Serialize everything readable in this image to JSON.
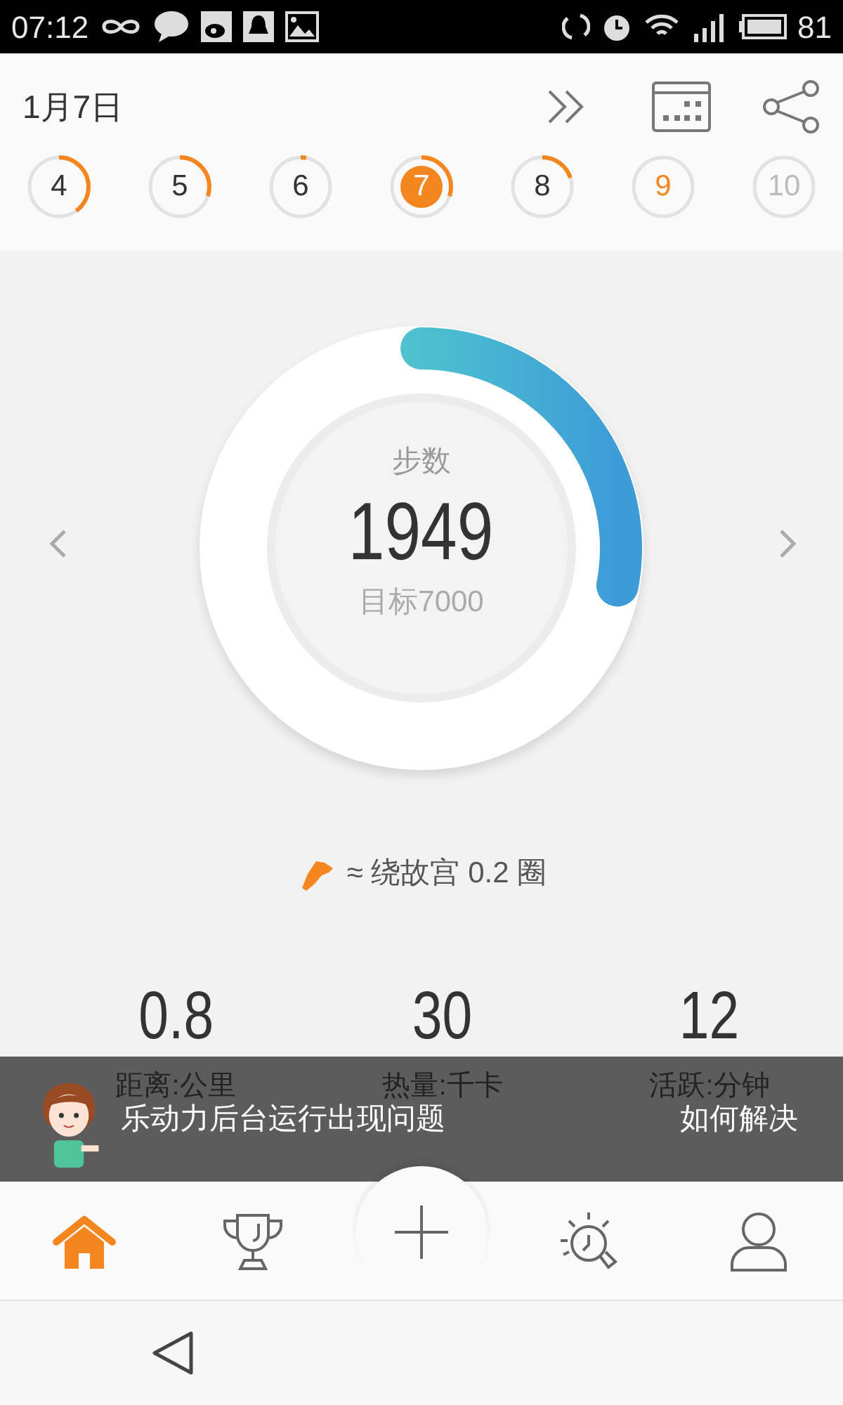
{
  "status_bar": {
    "time": "07:12",
    "battery": "81"
  },
  "header": {
    "date": "1月7日"
  },
  "days": [
    {
      "label": "4",
      "kind": "past",
      "level": 0.4,
      "selected": false
    },
    {
      "label": "5",
      "kind": "past",
      "level": 0.3,
      "selected": false
    },
    {
      "label": "6",
      "kind": "past",
      "level": 0.03,
      "selected": false
    },
    {
      "label": "7",
      "kind": "past",
      "level": 0.3,
      "selected": true
    },
    {
      "label": "8",
      "kind": "past",
      "level": 0.2,
      "selected": false
    },
    {
      "label": "9",
      "kind": "today",
      "selected": false
    },
    {
      "label": "10",
      "kind": "future",
      "selected": false
    }
  ],
  "steps": {
    "label": "步数",
    "value": "1949",
    "goal": "目标7000",
    "level": 0.28
  },
  "equivalent": "≈ 绕故宫 0.2 圈",
  "stats": [
    {
      "value": "0.8",
      "label": "距离:公里"
    },
    {
      "value": "30",
      "label": "热量:千卡"
    },
    {
      "value": "12",
      "label": "活跃:分钟"
    }
  ],
  "banner": {
    "message": "乐动力后台运行出现问题",
    "action": "如何解决"
  },
  "nav": [
    {
      "kind": "home",
      "selected": true
    },
    {
      "kind": "trophy",
      "selected": false
    },
    {
      "kind": "add",
      "selected": false
    },
    {
      "kind": "tips",
      "selected": false
    },
    {
      "kind": "profile",
      "selected": false
    }
  ]
}
